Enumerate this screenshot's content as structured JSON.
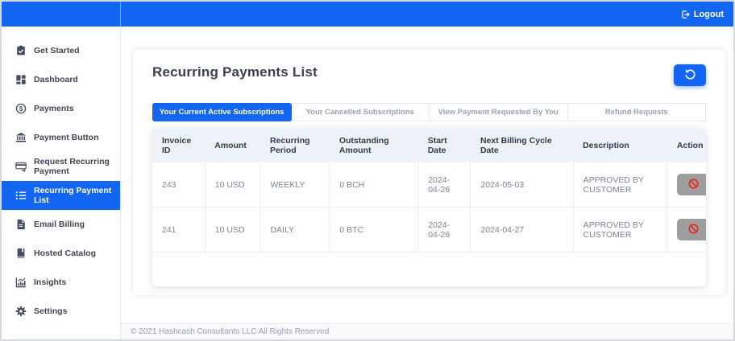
{
  "topbar": {
    "logout_label": "Logout"
  },
  "sidebar": {
    "items": [
      {
        "label": "Get Started",
        "icon": "clipboard-check-icon",
        "active": false
      },
      {
        "label": "Dashboard",
        "icon": "dashboard-grid-icon",
        "active": false
      },
      {
        "label": "Payments",
        "icon": "dollar-circle-icon",
        "active": false
      },
      {
        "label": "Payment Button",
        "icon": "bank-icon",
        "active": false
      },
      {
        "label": "Request Recurring Payment",
        "icon": "card-arrow-icon",
        "active": false
      },
      {
        "label": "Recurring Payment List",
        "icon": "list-icon",
        "active": true
      },
      {
        "label": "Email Billing",
        "icon": "file-icon",
        "active": false
      },
      {
        "label": "Hosted Catalog",
        "icon": "book-icon",
        "active": false
      },
      {
        "label": "Insights",
        "icon": "chart-icon",
        "active": false
      },
      {
        "label": "Settings",
        "icon": "gear-icon",
        "active": false
      }
    ]
  },
  "main": {
    "title": "Recurring Payments List",
    "refresh_button_icon": "history-icon",
    "tabs": [
      {
        "label": "Your Current Active Subscriptions",
        "active": true
      },
      {
        "label": "Your Cancelled Subscriptions",
        "active": false
      },
      {
        "label": "View Payment Requested By You",
        "active": false
      },
      {
        "label": "Refund Requests",
        "active": false
      }
    ],
    "table": {
      "columns": [
        "Invoice ID",
        "Amount",
        "Recurring Period",
        "Outstanding Amount",
        "Start Date",
        "Next Billing Cycle Date",
        "Description",
        "Action"
      ],
      "rows": [
        {
          "invoice_id": "243",
          "amount": "10 USD",
          "recurring_period": "WEEKLY",
          "outstanding_amount": "0 BCH",
          "start_date": "2024-04-26",
          "next_billing_cycle_date": "2024-05-03",
          "description": "APPROVED BY CUSTOMER",
          "action_icon": "block-icon"
        },
        {
          "invoice_id": "241",
          "amount": "10 USD",
          "recurring_period": "DAILY",
          "outstanding_amount": "0 BTC",
          "start_date": "2024-04-26",
          "next_billing_cycle_date": "2024-04-27",
          "description": "APPROVED BY CUSTOMER",
          "action_icon": "block-icon"
        }
      ]
    }
  },
  "footer": {
    "copyright": "© 2021 Hashcash Consultants LLC All Rights Reserved"
  },
  "colors": {
    "primary": "#1266f1",
    "table_header_bg": "#edf1f8",
    "action_button_bg": "#9e9e9e",
    "block_icon_red": "#e8261f",
    "sidebar_text": "#3f4653",
    "muted_text": "#9aa3b0"
  }
}
